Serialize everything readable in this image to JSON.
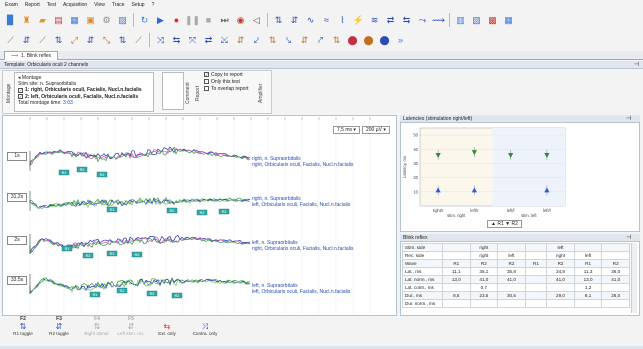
{
  "menu": [
    "Exam",
    "Report",
    "Test",
    "Acquisition",
    "View",
    "Trace",
    "Setup",
    "?"
  ],
  "tab": {
    "label": "1. Blink reflex"
  },
  "template_bar": {
    "title": "Template: Orbicularis oculi 2 channels"
  },
  "montage": {
    "vlabel": "Montage",
    "title": "Montage",
    "stim_site": "Stim site: n. Supraorbitalis",
    "row1": "1: right, Orbicularis oculi, Facialis, Nucl.n.facialis",
    "row2": "2: left, Orbicularis oculi, Facialis, Nucl.n.facialis",
    "total_label": "Total montage time:",
    "total_value": "3:03"
  },
  "comment": {
    "vlabel": "Comment"
  },
  "report": {
    "vlabel": "Report",
    "copy": "Copy to report",
    "only_this_test": "Only this test",
    "to_overlap": "To overlap report"
  },
  "amplifier": {
    "vlabel": "Amplifier"
  },
  "plot": {
    "sweep": "7,5 ms",
    "sensitivity": "200 µV",
    "channel_labels": [
      "1s",
      "31,2s",
      "2s",
      "33,5s"
    ],
    "traces": [
      {
        "title": "right, n. Supraorbitalis",
        "sub": "right, Orbicularis oculi, Facialis, Nucl.n.facialis"
      },
      {
        "title": "right, n. Supraorbitalis",
        "sub": "left, Orbicularis oculi, Facialis, Nucl.n.facialis"
      },
      {
        "title": "left, n. Supraorbitalis",
        "sub": "right, Orbicularis oculi, Facialis, Nucl.n.facialis"
      },
      {
        "title": "left, n. Supraorbitalis",
        "sub": "left, Orbicularis oculi, Facialis, Nucl.n.facialis"
      }
    ],
    "markers": [
      "R1",
      "R2",
      "R2",
      "R1",
      "R2",
      "R2",
      "R2",
      "R2",
      "R2",
      "R1",
      "R2",
      "R2",
      "R2",
      "R1",
      "R2"
    ]
  },
  "latencies": {
    "title": "Latencies (stimulation right/left)",
    "y_label": "Latency, ms",
    "y_ticks": [
      "50",
      "40",
      "30",
      "20",
      "10"
    ],
    "x_labels": [
      "right/r",
      "left/r",
      "left/l",
      "left/l"
    ],
    "x_groups": [
      "stim. right",
      "stim. left"
    ],
    "legend": "▲ R1  ▼ R2",
    "chart_data": {
      "type": "scatter",
      "categories": [
        "right/r",
        "left/r",
        "left/l",
        "left/l"
      ],
      "series": [
        {
          "name": "R1",
          "values": [
            11,
            11,
            null,
            11
          ],
          "color": "#2a5bd8"
        },
        {
          "name": "R2",
          "values": [
            36,
            38,
            36,
            36
          ],
          "color": "#2e8b3a"
        }
      ],
      "ylabel": "Latency, ms",
      "ylim": [
        0,
        55
      ]
    }
  },
  "blink_table": {
    "title": "Blink reflex",
    "rows": [
      [
        "Stim. side",
        "",
        "right",
        "",
        "",
        "left",
        "",
        ""
      ],
      [
        "Rec. side",
        "",
        "right",
        "left",
        "",
        "right",
        "left",
        ""
      ],
      [
        "Wave",
        "R1",
        "R2",
        "R2",
        "R1",
        "R2",
        "R1",
        "R2"
      ],
      [
        "Lat., ms",
        "11,1",
        "35,1",
        "35,8",
        "",
        "34,8",
        "11,3",
        "36,0"
      ],
      [
        "Lat. norm., ms",
        "13,0",
        "41,0",
        "41,0",
        "",
        "41,0",
        "13,0",
        "41,0"
      ],
      [
        "Lat. contr., ms",
        "",
        "0,7",
        "",
        "",
        "",
        "1,2",
        ""
      ],
      [
        "Dur., ms",
        "8,5",
        "23,5",
        "30,5",
        "",
        "29,0",
        "8,1",
        "26,0"
      ],
      [
        "Dur. norm., ms",
        "",
        "",
        "",
        "",
        "",
        "",
        ""
      ]
    ]
  },
  "fkeys": [
    {
      "key": "F2",
      "label": "R1 toggle",
      "enabled": true
    },
    {
      "key": "F3",
      "label": "R2 toggle",
      "enabled": true
    },
    {
      "key": "F4",
      "label": "Right stimul.",
      "enabled": false
    },
    {
      "key": "F5",
      "label": "Left stim. mc.",
      "enabled": false
    },
    {
      "key": "",
      "label": "Ext. only",
      "enabled": true
    },
    {
      "key": "",
      "label": "Contra. only",
      "enabled": true
    }
  ],
  "colors": {
    "accent": "#2a5bd8",
    "trace_blue": "#1d2fb8",
    "trace_green": "#2f9a3a",
    "trace_pink": "#d64ab8",
    "marker_bg": "#2fa8a8"
  }
}
